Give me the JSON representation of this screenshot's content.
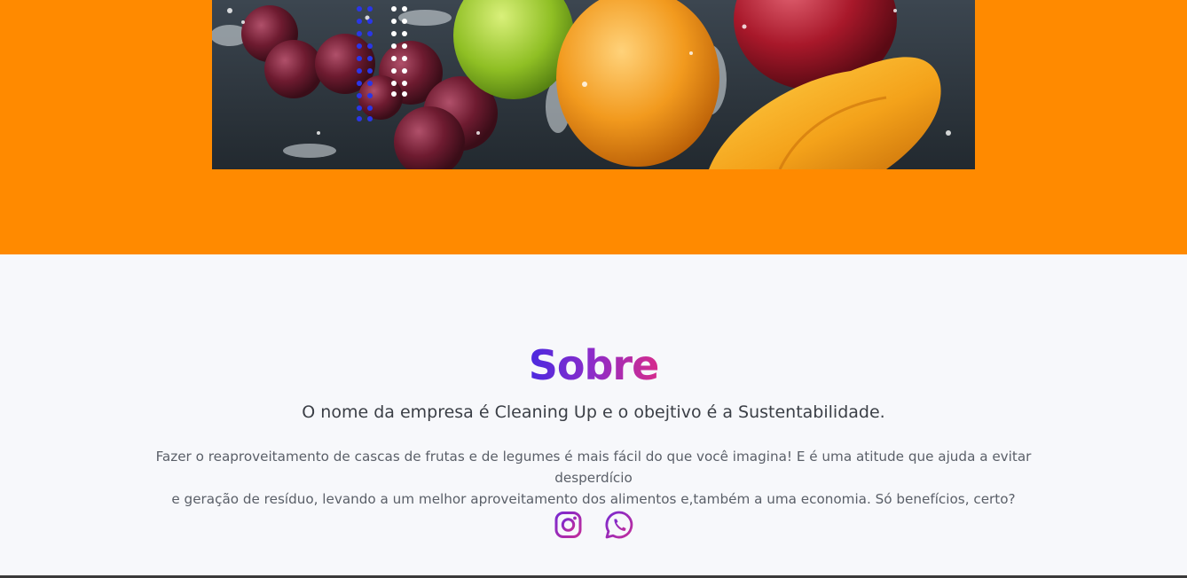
{
  "hero": {
    "background_color": "#ff8a00",
    "image_description_icon": "fruit-splash-image"
  },
  "about": {
    "title": "Sobre",
    "subtitle": "O nome da empresa é Cleaning Up e o obejtivo é a Sustentabilidade.",
    "paragraph_line1": "Fazer o reaproveitamento de cascas de frutas e de legumes é mais fácil do que você imagina! E é uma atitude que ajuda a evitar desperdício",
    "paragraph_line2": "e geração de resíduo, levando a um melhor aproveitamento dos alimentos e,também a uma economia. Só benefícios, certo?",
    "title_gradient": [
      "#4a2ae0",
      "#d52c8c"
    ],
    "text_color": "#3b3f46"
  },
  "socials": {
    "items": [
      {
        "icon": "instagram-icon"
      },
      {
        "icon": "whatsapp-icon"
      }
    ],
    "icon_color": "#9b2fae"
  }
}
